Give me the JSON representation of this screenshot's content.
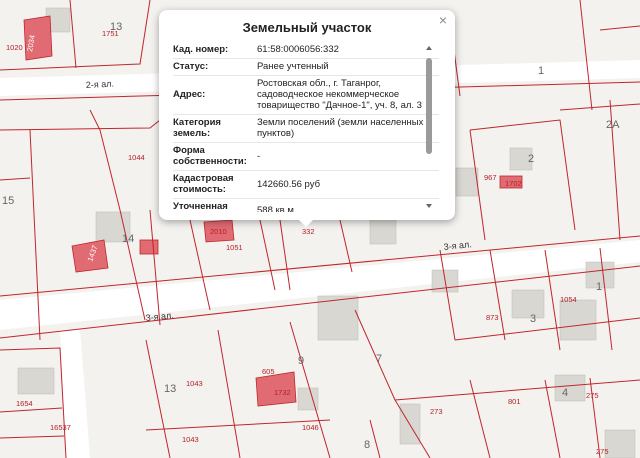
{
  "colors": {
    "background": "#f3f2ef",
    "parcel_border": "#c0262c",
    "building_fill": "#d9d7d2",
    "highlight_fill": "#e06b72",
    "road": "#ffffff"
  },
  "map": {
    "streets": {
      "second": "2-я ал.",
      "third_right": "3-я ал.",
      "third_left": "3-я ал."
    },
    "plot_numbers": {
      "p2034": "2034",
      "p1020": "1020",
      "p1751": "1751",
      "p13top": "13",
      "p1": "1",
      "p2a": "2А",
      "p2": "2",
      "p967": "967",
      "p1702": "1702",
      "p15": "15",
      "p1044": "1044",
      "p14": "14",
      "p1437": "1437",
      "p2010": "2010",
      "p1051": "1051",
      "p332": "332",
      "p1054": "1054",
      "p1right": "1",
      "p873": "873",
      "p3": "3",
      "p7": "7",
      "p9": "9",
      "p605": "605",
      "p1732": "1732",
      "p13": "13",
      "p1043a": "1043",
      "p1043b": "1043",
      "p1046": "1046",
      "p1654": "1654",
      "p16537": "16537",
      "p8": "8",
      "p273": "273",
      "p801": "801",
      "p4": "4",
      "p275a": "275",
      "p275b": "275"
    }
  },
  "popup": {
    "title": "Земельный участок",
    "close_symbol": "×",
    "rows": [
      {
        "key": "Кад. номер:",
        "value": "61:58:0006056:332"
      },
      {
        "key": "Статус:",
        "value": "Ранее учтенный"
      },
      {
        "key": "Адрес:",
        "value": "Ростовская обл., г. Таганрог, садоводческое некоммерческое товарищество \"Дачное-1\", уч. 8, ал. 3"
      },
      {
        "key": "Категория земель:",
        "value": "Земли поселений (земли населенных пунктов)"
      },
      {
        "key": "Форма собственности:",
        "value": "-"
      },
      {
        "key": "Кадастровая стоимость:",
        "value": "142660.56 руб"
      },
      {
        "key": "Уточненная площадь:",
        "value": "588 кв.м"
      }
    ]
  }
}
